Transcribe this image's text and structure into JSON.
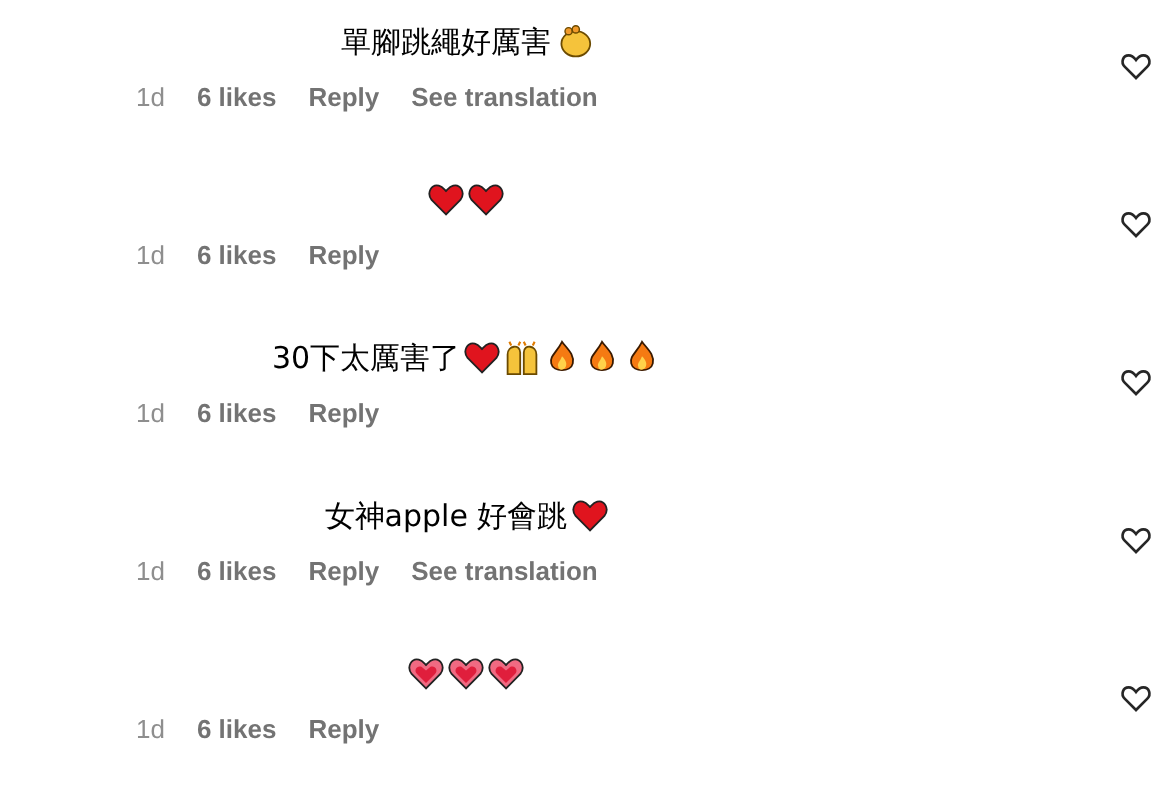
{
  "comments": [
    {
      "text": "單腳跳繩好厲害",
      "emojis": [
        {
          "kind": "clap"
        }
      ],
      "time": "1d",
      "likes": "6 likes",
      "reply": "Reply",
      "translation": "See translation",
      "liked": false
    },
    {
      "emojis": [
        {
          "kind": "red-heart"
        },
        {
          "kind": "red-heart"
        }
      ],
      "time": "1d",
      "likes": "6 likes",
      "reply": "Reply",
      "liked": false
    },
    {
      "text": "30下太厲害了",
      "emojis": [
        {
          "kind": "red-heart"
        },
        {
          "kind": "raising-hands"
        },
        {
          "kind": "fire"
        },
        {
          "kind": "fire"
        },
        {
          "kind": "fire"
        }
      ],
      "time": "1d",
      "likes": "6 likes",
      "reply": "Reply",
      "liked": false
    },
    {
      "text": "女神apple 好會跳",
      "emojis": [
        {
          "kind": "red-heart"
        }
      ],
      "time": "1d",
      "likes": "6 likes",
      "reply": "Reply",
      "translation": "See translation",
      "liked": false
    },
    {
      "emojis": [
        {
          "kind": "pink-heart"
        },
        {
          "kind": "pink-heart"
        },
        {
          "kind": "pink-heart"
        }
      ],
      "time": "1d",
      "likes": "6 likes",
      "reply": "Reply",
      "liked": false
    }
  ]
}
